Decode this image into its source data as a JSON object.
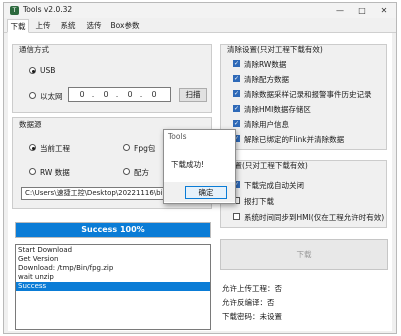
{
  "window": {
    "title": "Tools v2.0.32",
    "icon": "app-icon"
  },
  "tabs": [
    {
      "label": "下载",
      "active": true
    },
    {
      "label": "上传",
      "active": false
    },
    {
      "label": "系统",
      "active": false
    },
    {
      "label": "选传",
      "active": false
    },
    {
      "label": "Box参数",
      "active": false
    }
  ],
  "comm": {
    "title": "通信方式",
    "usb_label": "USB",
    "ethernet_label": "以太网",
    "ip": [
      "0",
      "0",
      "0",
      "0"
    ],
    "scan_label": "扫描"
  },
  "source": {
    "title": "数据源",
    "current_project": "当前工程",
    "fpg_pack": "Fpg包",
    "rw_data": "RW 数据",
    "recipe": "配方",
    "path": "C:\\Users\\速捷工控\\Desktop\\20221116\\bin"
  },
  "progress": {
    "text": "Success 100%",
    "value": 100
  },
  "log": [
    "Start Download",
    "Get  Version",
    "Download: /tmp/Bin/fpg.zip",
    "wait unzip",
    "Success"
  ],
  "clear": {
    "title": "清除设置(只对工程下载有效)",
    "items": [
      {
        "label": "清除RW数据",
        "checked": true
      },
      {
        "label": "清除配方数据",
        "checked": true
      },
      {
        "label": "清除数据采样记录和报警事件历史记录",
        "checked": true
      },
      {
        "label": "清除HMI数据存储区",
        "checked": true
      },
      {
        "label": "清除用户信息",
        "checked": true
      },
      {
        "label": "解除已绑定的Flink并清除数据",
        "checked": true
      }
    ]
  },
  "other": {
    "title": "设置(只对工程下载有效)",
    "items": [
      {
        "label": "下载完成自动关闭",
        "checked": true
      },
      {
        "label": "报打下载",
        "checked": false
      },
      {
        "label": "系统时间同步到HMI(仅在工程允许时有效)",
        "checked": false
      }
    ]
  },
  "download_button": "下载",
  "info": [
    {
      "label": "允许上传工程：",
      "value": "否"
    },
    {
      "label": "允许反编译：",
      "value": "否"
    },
    {
      "label": "下载密码：",
      "value": "未设置"
    }
  ],
  "dialog": {
    "title": "Tools",
    "message": "下载成功!",
    "ok_label": "确定"
  },
  "colors": {
    "accent": "#0a7cd6",
    "check": "#2f6ab8"
  }
}
